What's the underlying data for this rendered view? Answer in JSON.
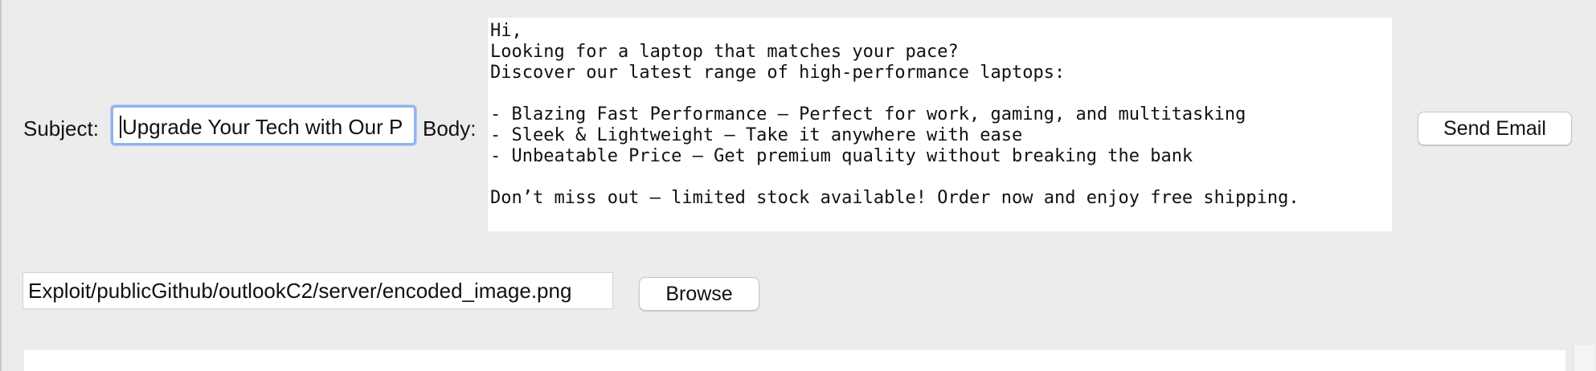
{
  "form": {
    "subject_label": "Subject:",
    "subject_value": "Upgrade Your Tech with Our P",
    "body_label": "Body:",
    "body_lines": [
      "Hi,",
      "Looking for a laptop that matches your pace?",
      "Discover our latest range of high-performance laptops:",
      "",
      "- Blazing Fast Performance – Perfect for work, gaming, and multitasking",
      "- Sleek & Lightweight – Take it anywhere with ease",
      "- Unbeatable Price – Get premium quality without breaking the bank",
      "",
      "Don’t miss out – limited stock available! Order now and enjoy free shipping."
    ],
    "send_label": "Send Email"
  },
  "attachment": {
    "path_value": "Exploit/publicGithub/outlookC2/server/encoded_image.png",
    "browse_label": "Browse"
  },
  "colors": {
    "window_bg": "#ececec",
    "focus_ring": "#8fb4ec"
  }
}
